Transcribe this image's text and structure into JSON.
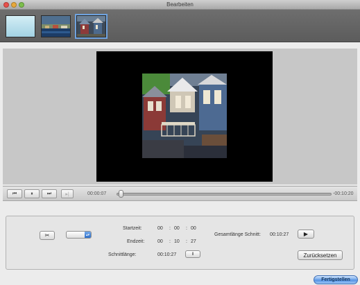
{
  "window": {
    "title": "Bearbeiten"
  },
  "clips": [
    {
      "name": "clip-1"
    },
    {
      "name": "clip-2"
    },
    {
      "name": "clip-3",
      "selected": true
    }
  ],
  "transport": {
    "current_time": "00:00:07",
    "remaining_time": "-00:10:20",
    "progress": 0.01
  },
  "edit": {
    "start_label": "Startzeit:",
    "start": [
      "00",
      "00",
      "00"
    ],
    "end_label": "Endzeit:",
    "end": [
      "00",
      "10",
      "27"
    ],
    "cut_length_label": "Schnittlänge:",
    "cut_length": "00:10:27",
    "total_label": "Gesamtlänge Schnitt:",
    "total": "00:10:27",
    "colon": ":",
    "reset_label": "Zurücksetzen"
  },
  "finish_label": "Fertigstellen",
  "icons": {
    "scissors": "scissors-icon",
    "play": "play-icon"
  },
  "colors": {
    "accent": "#4f8fe3",
    "selection": "#6fa3e0"
  }
}
